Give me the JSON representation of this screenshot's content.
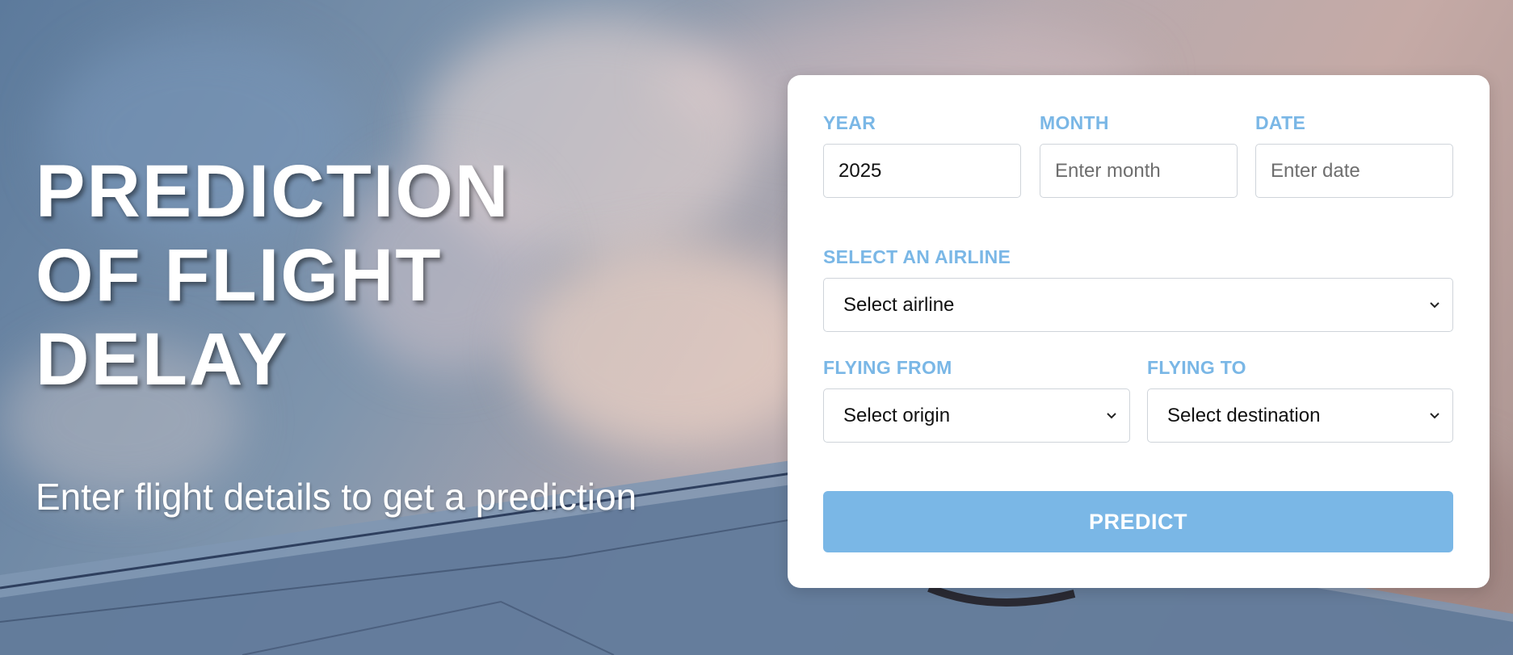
{
  "hero": {
    "title_lines": [
      "PREDICTION",
      "OF FLIGHT",
      "DELAY"
    ],
    "subtitle": "Enter flight details to get a prediction"
  },
  "form": {
    "year": {
      "label": "YEAR",
      "value": "2025",
      "placeholder": "Enter year"
    },
    "month": {
      "label": "MONTH",
      "value": "",
      "placeholder": "Enter month"
    },
    "date": {
      "label": "DATE",
      "value": "",
      "placeholder": "Enter date"
    },
    "airline": {
      "label": "SELECT AN AIRLINE",
      "selected": "Select airline"
    },
    "origin": {
      "label": "FLYING FROM",
      "selected": "Select origin"
    },
    "destination": {
      "label": "FLYING TO",
      "selected": "Select destination"
    },
    "predict_label": "PREDICT"
  },
  "icons": {
    "select_chevron": "chevron-down-icon"
  },
  "colors": {
    "accent": "#7ab7e6",
    "card_bg": "#ffffff",
    "hero_text": "#ffffff"
  }
}
